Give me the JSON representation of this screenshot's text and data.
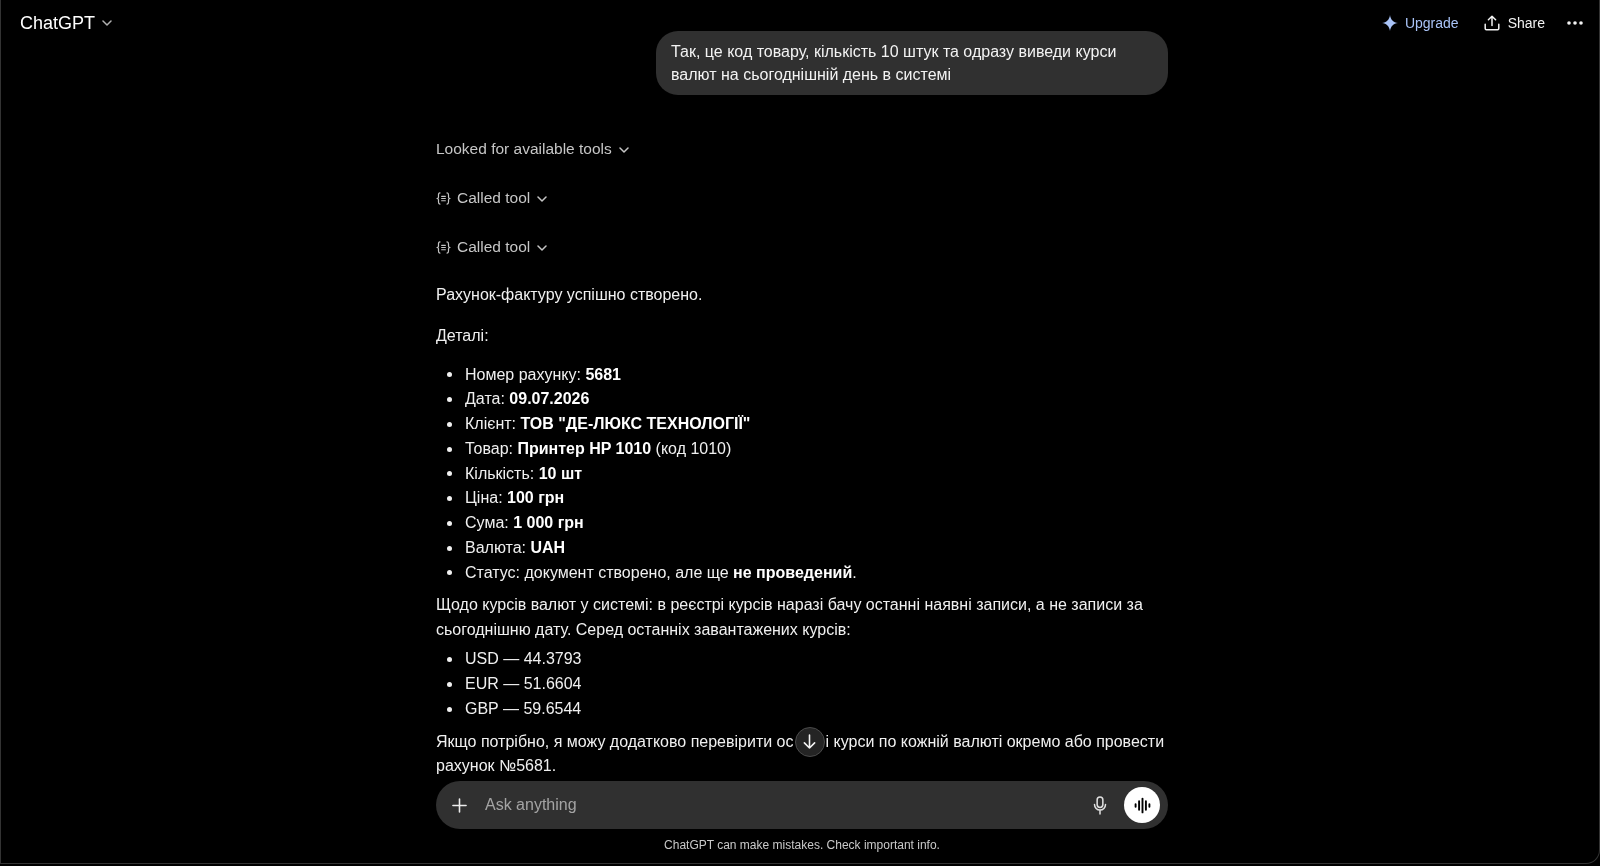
{
  "header": {
    "title": "ChatGPT",
    "actions": [
      {
        "kind": "upgrade",
        "label": "Upgrade"
      },
      {
        "kind": "share",
        "label": "Share"
      },
      {
        "kind": "more"
      }
    ]
  },
  "conversation": {
    "user_message": "Так, це код товару, кількість 10 штук та одразу виведи курси валют на сьогоднішній день в системі",
    "tool_steps": [
      {
        "kind": "search",
        "label": "Looked for available tools"
      },
      {
        "kind": "call",
        "label": "Called tool"
      },
      {
        "kind": "call",
        "label": "Called tool"
      }
    ],
    "response": [
      {
        "kind": "paragraph",
        "text": "Рахунок-фактуру успішно створено."
      },
      {
        "kind": "paragraph",
        "text": "Деталі:"
      },
      {
        "kind": "list",
        "items": [
          "Номер рахунку: **5681**",
          "Дата: **09.07.2026**",
          "Клієнт: **ТОВ \"ДЕ-ЛЮКС ТЕХНОЛОГІЇ\"**",
          "Товар: **Принтер HP 1010** (код 1010)",
          "Кількість: **10 шт**",
          "Ціна: **100 грн**",
          "Сума: **1 000 грн**",
          "Валюта: **UAH**",
          "Статус: документ створено, але ще **не проведений**."
        ]
      },
      {
        "kind": "paragraph",
        "text": "Щодо курсів валют у системі: в реєстрі курсів наразі бачу останні наявні записи, а не записи за сьогоднішню дату. Серед останніх завантажених курсів:"
      },
      {
        "kind": "list",
        "items": [
          "USD — 44.3793",
          "EUR — 51.6604",
          "GBP — 59.6544"
        ]
      },
      {
        "kind": "covered_paragraph",
        "before": "Якщо потрібно, я можу додатково перевірити ос",
        "after": "і курси по кожній валюті окремо або провести",
        "continuation": "рахунок №5681."
      }
    ]
  },
  "composer": {
    "placeholder": "Ask anything"
  },
  "disclaimer": "ChatGPT can make mistakes. Check important info."
}
